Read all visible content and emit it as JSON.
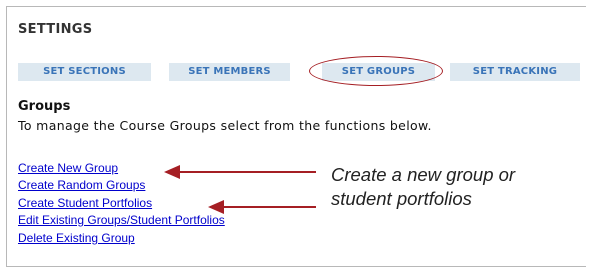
{
  "settings": {
    "title": "SETTINGS",
    "tabs": [
      {
        "label": "SET SECTIONS"
      },
      {
        "label": "SET MEMBERS"
      },
      {
        "label": "SET GROUPS"
      },
      {
        "label": "SET TRACKING"
      }
    ],
    "highlighted_tab": "SET GROUPS",
    "highlight_color": "#a51f24",
    "tab_background": "#dde8f0",
    "tab_text_color": "#3a74b8"
  },
  "groups": {
    "heading": "Groups",
    "description": "To manage the Course Groups select from the functions below.",
    "links": [
      {
        "label": "Create New Group"
      },
      {
        "label": "Create Random Groups"
      },
      {
        "label": "Create Student Portfolios"
      },
      {
        "label": "Edit Existing Groups/Student Portfolios"
      },
      {
        "label": "Delete Existing Group"
      }
    ],
    "link_color": "#0000cc"
  },
  "annotation": {
    "line1": "Create a new group or",
    "line2": "student portfolios",
    "arrow_color": "#a51f24"
  }
}
